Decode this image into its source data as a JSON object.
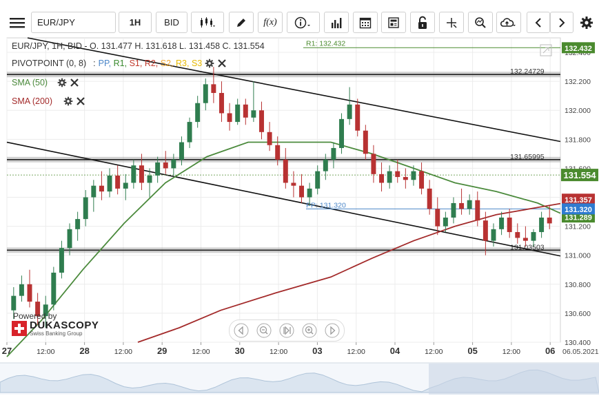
{
  "toolbar": {
    "symbol": "EUR/JPY",
    "timeframe": "1H",
    "price_type": "BID",
    "fx_label": "f(x)"
  },
  "header": {
    "ohlc": "EUR/JPY, 1H, BID - O. 131.477 H. 131.618 L. 131.458 C. 131.554",
    "pivot_name": "PIVOTPOINT (0, 8)",
    "pivot_items": [
      {
        "label": "PP,",
        "color": "#4a86c8"
      },
      {
        "label": "R1,",
        "color": "#3a8a2e"
      },
      {
        "label": "S1,",
        "color": "#c0392b"
      },
      {
        "label": "R2,",
        "color": "#c0392b"
      },
      {
        "label": "S2,",
        "color": "#f0a830"
      },
      {
        "label": "R3,",
        "color": "#e6b800"
      },
      {
        "label": "S3",
        "color": "#e6b800"
      }
    ],
    "sma50": "SMA (50)",
    "sma200": "SMA (200)"
  },
  "branding": {
    "powered_by": "Powered by",
    "name": "DUKASCOPY",
    "tagline": "Swiss Banking Group"
  },
  "colors": {
    "candle_up": "#2f7d4f",
    "candle_down": "#b83232",
    "sma50": "#4b8a3c",
    "sma200": "#a32a2a",
    "pp": "#4a86c8",
    "r1": "#4a8a2e",
    "price_badge": "#4a8a2e",
    "sma200_badge": "#b83232",
    "pp_badge": "#2f7bd0"
  },
  "chart_data": {
    "type": "candlestick",
    "symbol": "EUR/JPY",
    "timeframe": "1H",
    "ylim": [
      130.4,
      132.5
    ],
    "y_ticks": [
      "132.400",
      "132.200",
      "132.000",
      "131.800",
      "131.600",
      "131.400",
      "131.200",
      "131.000",
      "130.800",
      "130.600",
      "130.400"
    ],
    "x_ticks": [
      "27",
      "12:00",
      "28",
      "12:00",
      "29",
      "12:00",
      "30",
      "12:00",
      "03",
      "12:00",
      "04",
      "12:00",
      "05",
      "12:00",
      "06"
    ],
    "last_date": "06.05.2021",
    "ohlc_last": {
      "open": 131.477,
      "high": 131.618,
      "low": 131.458,
      "close": 131.554
    },
    "price_label": "131.554",
    "levels": [
      {
        "name": "R1",
        "value": 132.432,
        "label": "R1: 132.432",
        "badge": "132.432"
      },
      {
        "name": "PP",
        "value": 131.32,
        "label": "PP: 131.320",
        "badge": "131.320"
      },
      {
        "name": "SMA200",
        "value": 131.357,
        "badge": "131.357"
      },
      {
        "name": "SMA50",
        "value": 131.289,
        "badge": "131.289"
      }
    ],
    "horizontal_lines": [
      {
        "value": 132.24729,
        "label": "132.24729"
      },
      {
        "value": 131.65995,
        "label": "131.65995"
      },
      {
        "value": 131.03503,
        "label": "131.03503"
      }
    ],
    "candles": [
      [
        130.62,
        130.78,
        130.56,
        130.72
      ],
      [
        130.72,
        130.86,
        130.68,
        130.8
      ],
      [
        130.8,
        130.9,
        130.64,
        130.68
      ],
      [
        130.68,
        130.74,
        130.52,
        130.58
      ],
      [
        130.58,
        130.72,
        130.5,
        130.66
      ],
      [
        130.66,
        130.92,
        130.62,
        130.88
      ],
      [
        130.88,
        131.1,
        130.84,
        131.05
      ],
      [
        131.05,
        131.22,
        131.0,
        131.18
      ],
      [
        131.18,
        131.3,
        131.1,
        131.25
      ],
      [
        131.25,
        131.45,
        131.2,
        131.4
      ],
      [
        131.4,
        131.52,
        131.3,
        131.48
      ],
      [
        131.48,
        131.58,
        131.38,
        131.44
      ],
      [
        131.44,
        131.6,
        131.4,
        131.55
      ],
      [
        131.55,
        131.62,
        131.42,
        131.46
      ],
      [
        131.46,
        131.56,
        131.38,
        131.5
      ],
      [
        131.5,
        131.66,
        131.46,
        131.62
      ],
      [
        131.62,
        131.7,
        131.45,
        131.5
      ],
      [
        131.5,
        131.6,
        131.4,
        131.55
      ],
      [
        131.55,
        131.68,
        131.5,
        131.64
      ],
      [
        131.64,
        131.72,
        131.56,
        131.6
      ],
      [
        131.6,
        131.7,
        131.55,
        131.66
      ],
      [
        131.66,
        131.82,
        131.62,
        131.78
      ],
      [
        131.78,
        131.95,
        131.74,
        131.92
      ],
      [
        131.92,
        132.1,
        131.88,
        132.05
      ],
      [
        132.05,
        132.22,
        132.0,
        132.18
      ],
      [
        132.18,
        132.3,
        132.05,
        132.12
      ],
      [
        132.12,
        132.2,
        131.92,
        131.98
      ],
      [
        131.98,
        132.05,
        131.86,
        131.92
      ],
      [
        131.92,
        132.08,
        131.9,
        132.04
      ],
      [
        132.04,
        132.08,
        131.9,
        131.95
      ],
      [
        131.95,
        132.2,
        131.92,
        132.0
      ],
      [
        132.0,
        132.06,
        131.8,
        131.85
      ],
      [
        131.85,
        131.92,
        131.72,
        131.76
      ],
      [
        131.76,
        131.82,
        131.62,
        131.66
      ],
      [
        131.66,
        131.74,
        131.46,
        131.5
      ],
      [
        131.5,
        131.58,
        131.4,
        131.48
      ],
      [
        131.48,
        131.56,
        131.36,
        131.4
      ],
      [
        131.4,
        131.5,
        131.34,
        131.46
      ],
      [
        131.46,
        131.62,
        131.42,
        131.58
      ],
      [
        131.58,
        131.7,
        131.52,
        131.66
      ],
      [
        131.66,
        131.78,
        131.6,
        131.74
      ],
      [
        131.74,
        131.98,
        131.7,
        131.94
      ],
      [
        131.94,
        132.16,
        131.9,
        132.04
      ],
      [
        132.04,
        132.08,
        131.82,
        131.86
      ],
      [
        131.86,
        131.9,
        131.66,
        131.7
      ],
      [
        131.7,
        131.76,
        131.5,
        131.56
      ],
      [
        131.56,
        131.64,
        131.44,
        131.5
      ],
      [
        131.5,
        131.62,
        131.46,
        131.58
      ],
      [
        131.58,
        131.66,
        131.5,
        131.54
      ],
      [
        131.54,
        131.6,
        131.46,
        131.52
      ],
      [
        131.52,
        131.62,
        131.48,
        131.58
      ],
      [
        131.58,
        131.64,
        131.42,
        131.46
      ],
      [
        131.46,
        131.52,
        131.28,
        131.32
      ],
      [
        131.32,
        131.4,
        131.14,
        131.2
      ],
      [
        131.2,
        131.3,
        131.16,
        131.26
      ],
      [
        131.26,
        131.4,
        131.22,
        131.36
      ],
      [
        131.36,
        131.46,
        131.28,
        131.32
      ],
      [
        131.32,
        131.42,
        131.28,
        131.38
      ],
      [
        131.38,
        131.44,
        131.2,
        131.24
      ],
      [
        131.24,
        131.3,
        131.0,
        131.1
      ],
      [
        131.1,
        131.22,
        131.06,
        131.18
      ],
      [
        131.18,
        131.3,
        131.14,
        131.26
      ],
      [
        131.26,
        131.32,
        131.12,
        131.16
      ],
      [
        131.16,
        131.22,
        131.08,
        131.12
      ],
      [
        131.12,
        131.2,
        131.06,
        131.1
      ],
      [
        131.1,
        131.18,
        131.06,
        131.16
      ],
      [
        131.16,
        131.3,
        131.12,
        131.26
      ],
      [
        131.26,
        131.34,
        131.18,
        131.22
      ]
    ]
  }
}
